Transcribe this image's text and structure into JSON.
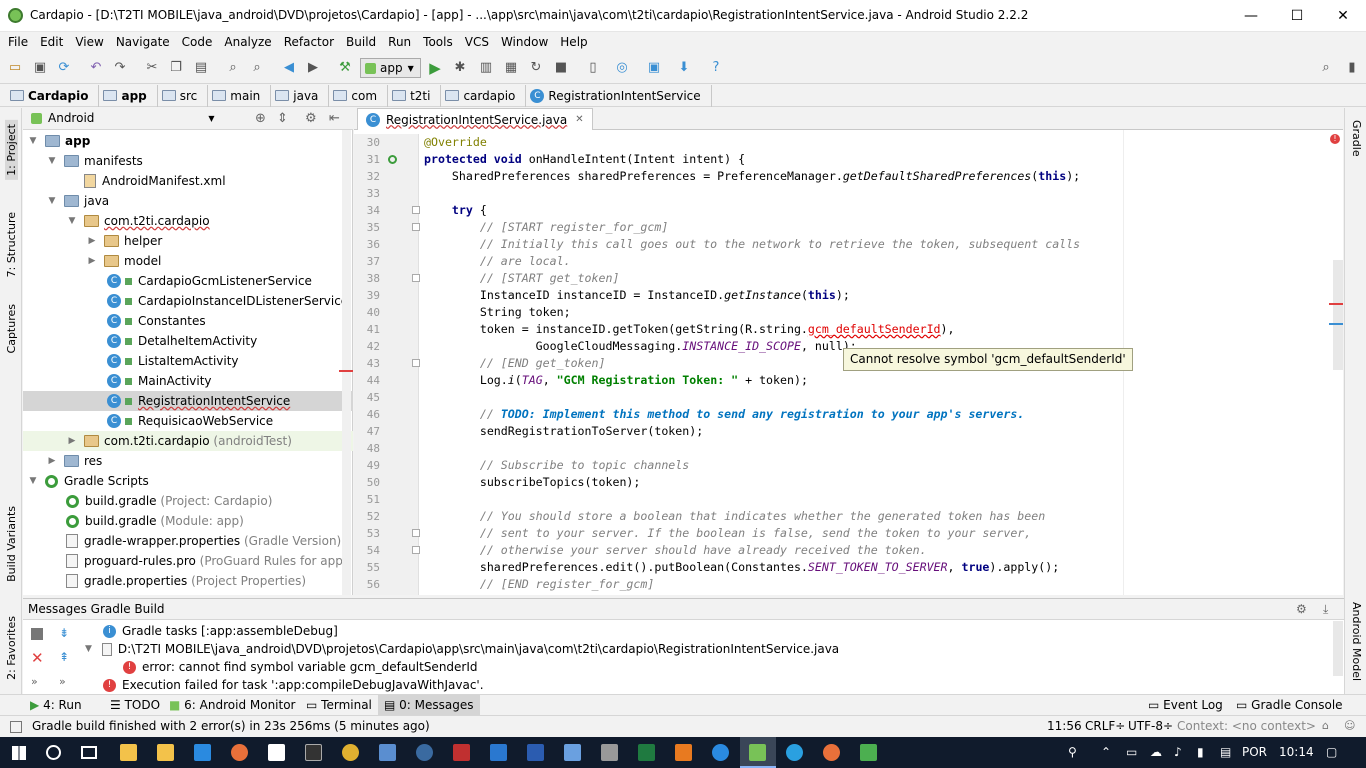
{
  "window": {
    "title": "Cardapio - [D:\\T2TI MOBILE\\java_android\\DVD\\projetos\\Cardapio] - [app] - ...\\app\\src\\main\\java\\com\\t2ti\\cardapio\\RegistrationIntentService.java - Android Studio 2.2.2",
    "minimize": "—",
    "maximize": "☐",
    "close": "✕"
  },
  "menu": [
    "File",
    "Edit",
    "View",
    "Navigate",
    "Code",
    "Analyze",
    "Refactor",
    "Build",
    "Run",
    "Tools",
    "VCS",
    "Window",
    "Help"
  ],
  "toolbar": {
    "run_config": "app"
  },
  "breadcrumb": [
    "Cardapio",
    "app",
    "src",
    "main",
    "java",
    "com",
    "t2ti",
    "cardapio",
    "RegistrationIntentService"
  ],
  "project_panel": {
    "view_mode": "Android",
    "tree": [
      {
        "label": "app",
        "bold": true
      },
      {
        "label": "manifests"
      },
      {
        "label": "AndroidManifest.xml"
      },
      {
        "label": "java"
      },
      {
        "label": "com.t2ti.cardapio"
      },
      {
        "label": "helper"
      },
      {
        "label": "model"
      },
      {
        "label": "CardapioGcmListenerService"
      },
      {
        "label": "CardapioInstanceIDListenerService"
      },
      {
        "label": "Constantes"
      },
      {
        "label": "DetalheItemActivity"
      },
      {
        "label": "ListaItemActivity"
      },
      {
        "label": "MainActivity"
      },
      {
        "label": "RegistrationIntentService"
      },
      {
        "label": "RequisicaoWebService"
      },
      {
        "label": "com.t2ti.cardapio",
        "suffix": "(androidTest)"
      },
      {
        "label": "res"
      },
      {
        "label": "Gradle Scripts"
      },
      {
        "label": "build.gradle",
        "suffix": "(Project: Cardapio)"
      },
      {
        "label": "build.gradle",
        "suffix": "(Module: app)"
      },
      {
        "label": "gradle-wrapper.properties",
        "suffix": "(Gradle Version)"
      },
      {
        "label": "proguard-rules.pro",
        "suffix": "(ProGuard Rules for app)"
      },
      {
        "label": "gradle.properties",
        "suffix": "(Project Properties)"
      }
    ]
  },
  "editor": {
    "tab": "RegistrationIntentService.java",
    "line_numbers": [
      "30",
      "31",
      "32",
      "33",
      "34",
      "35",
      "36",
      "37",
      "38",
      "39",
      "40",
      "41",
      "42",
      "43",
      "44",
      "45",
      "46",
      "47",
      "48",
      "49",
      "50",
      "51",
      "52",
      "53",
      "54",
      "55",
      "56"
    ],
    "code": {
      "l30": "@Override",
      "l31a": "protected void",
      "l31b": " onHandleIntent(Intent intent) {",
      "l32a": "    SharedPreferences sharedPreferences = PreferenceManager.",
      "l32b": "getDefaultSharedPreferences",
      "l32c": "(",
      "l32d": "this",
      "l32e": ");",
      "l34a": "    try",
      "l34b": " {",
      "l35": "        // [START register_for_gcm]",
      "l36": "        // Initially this call goes out to the network to retrieve the token, subsequent calls",
      "l37": "        // are local.",
      "l38": "        // [START get_token]",
      "l39a": "        InstanceID instanceID = InstanceID.",
      "l39b": "getInstance",
      "l39c": "(",
      "l39d": "this",
      "l39e": ");",
      "l40": "        String token;",
      "l41a": "        token = instanceID.getToken(getString(R.string.",
      "l41b": "gcm_defaultSenderId",
      "l41c": "),",
      "l42a": "                GoogleCloudMessaging.",
      "l42b": "INSTANCE_ID_SCOPE",
      "l42c": ", null);",
      "l43": "        // [END get_token]",
      "l44a": "        Log.",
      "l44b": "i",
      "l44c": "(",
      "l44d": "TAG",
      "l44e": ", ",
      "l44f": "\"GCM Registration Token: \"",
      "l44g": " + token);",
      "l46a": "        // ",
      "l46b": "TODO: Implement this method to send any registration to your app's servers.",
      "l47": "        sendRegistrationToServer(token);",
      "l49": "        // Subscribe to topic channels",
      "l50": "        subscribeTopics(token);",
      "l52": "        // You should store a boolean that indicates whether the generated token has been",
      "l53": "        // sent to your server. If the boolean is false, send the token to your server,",
      "l54": "        // otherwise your server should have already received the token.",
      "l55a": "        sharedPreferences.edit().putBoolean(Constantes.",
      "l55b": "SENT_TOKEN_TO_SERVER",
      "l55c": ", ",
      "l55d": "true",
      "l55e": ").apply();",
      "l56": "        // [END register_for_gcm]"
    },
    "tooltip": "Cannot resolve symbol 'gcm_defaultSenderId'"
  },
  "messages": {
    "header": "Messages Gradle Build",
    "items": [
      "Gradle tasks [:app:assembleDebug]",
      "D:\\T2TI MOBILE\\java_android\\DVD\\projetos\\Cardapio\\app\\src\\main\\java\\com\\t2ti\\cardapio\\RegistrationIntentService.java",
      "error: cannot find symbol variable gcm_defaultSenderId",
      "Execution failed for task ':app:compileDebugJavaWithJavac'."
    ]
  },
  "left_stripe": [
    "1: Project",
    "7: Structure",
    "Captures",
    "Build Variants",
    "2: Favorites"
  ],
  "right_stripe": [
    "Gradle",
    "Android Model"
  ],
  "tool_tabs": {
    "run": "4: Run",
    "todo": "TODO",
    "android_monitor": "6: Android Monitor",
    "terminal": "Terminal",
    "messages": "0: Messages",
    "event_log": "Event Log",
    "gradle_console": "Gradle Console"
  },
  "status": {
    "text": "Gradle build finished with 2 error(s) in 23s 256ms (5 minutes ago)",
    "position": "11:56",
    "line_sep": "CRLF÷",
    "encoding": "UTF-8÷",
    "context": "Context: <no context>"
  },
  "taskbar": {
    "lang": "POR",
    "time": "10:14"
  }
}
